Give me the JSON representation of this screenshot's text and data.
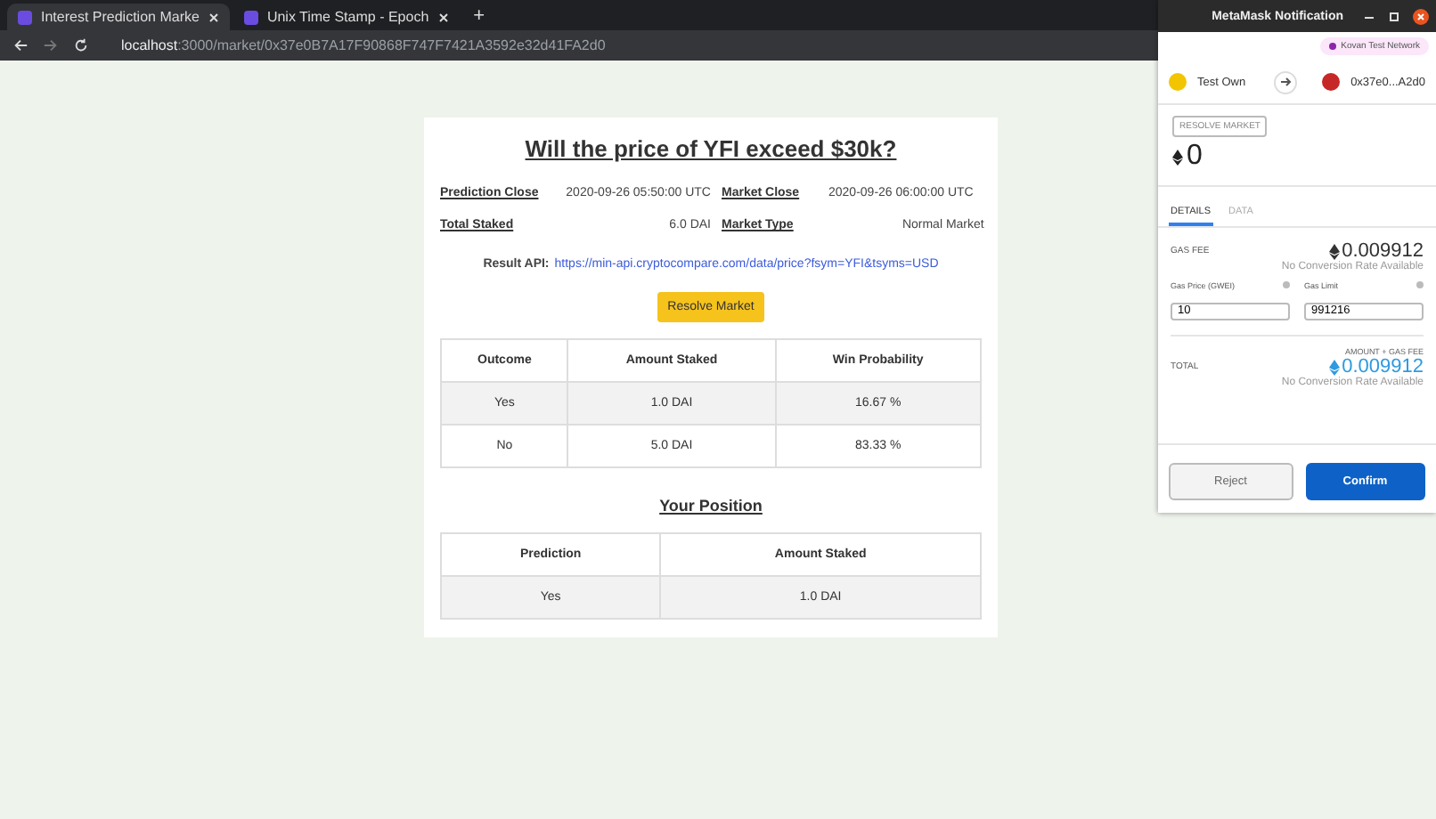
{
  "browser": {
    "tabs": [
      {
        "title": "Interest Prediction Marke",
        "selected": true
      },
      {
        "title": "Unix Time Stamp - Epoch",
        "selected": false
      }
    ],
    "new_tab": "+",
    "url_host": "localhost",
    "url_path": ":3000/market/0x37e0B7A17F90868F747F7421A3592e32d41FA2d0"
  },
  "market": {
    "title": "Will the price of YFI exceed $30k?",
    "details": [
      {
        "label": "Prediction Close",
        "value": "2020-09-26 05:50:00 UTC"
      },
      {
        "label": "Market Close",
        "value": "2020-09-26 06:00:00 UTC"
      },
      {
        "label": "Total Staked",
        "value": "6.0 DAI"
      },
      {
        "label": "Market Type",
        "value": "Normal Market"
      }
    ],
    "result_api_label": "Result API:",
    "result_api_url": "https://min-api.cryptocompare.com/data/price?fsym=YFI&tsyms=USD",
    "resolve_button": "Resolve Market",
    "outcomes": {
      "columns": [
        "Outcome",
        "Amount Staked",
        "Win Probability"
      ],
      "rows": [
        [
          "Yes",
          "1.0 DAI",
          "16.67 %"
        ],
        [
          "No",
          "5.0 DAI",
          "83.33 %"
        ]
      ]
    },
    "position_title": "Your Position",
    "position": {
      "columns": [
        "Prediction",
        "Amount Staked"
      ],
      "rows": [
        [
          "Yes",
          "1.0 DAI"
        ]
      ]
    }
  },
  "metamask": {
    "title": "MetaMask Notification",
    "network": "Kovan Test Network",
    "from": "Test Own",
    "to": "0x37e0...A2d0",
    "method": "RESOLVE MARKET",
    "amount": "0",
    "tabs": [
      {
        "label": "DETAILS",
        "selected": true
      },
      {
        "label": "DATA",
        "selected": false
      }
    ],
    "gas_fee_label": "GAS FEE",
    "gas_fee": "0.009912",
    "no_rate": "No Conversion Rate Available",
    "gas_price_label": "Gas Price (GWEI)",
    "gas_price": "10",
    "gas_limit_label": "Gas Limit",
    "gas_limit": "991216",
    "total_caption": "AMOUNT + GAS FEE",
    "total_label": "TOTAL",
    "total": "0.009912",
    "total_no_rate": "No Conversion Rate Available",
    "reject": "Reject",
    "confirm": "Confirm"
  }
}
